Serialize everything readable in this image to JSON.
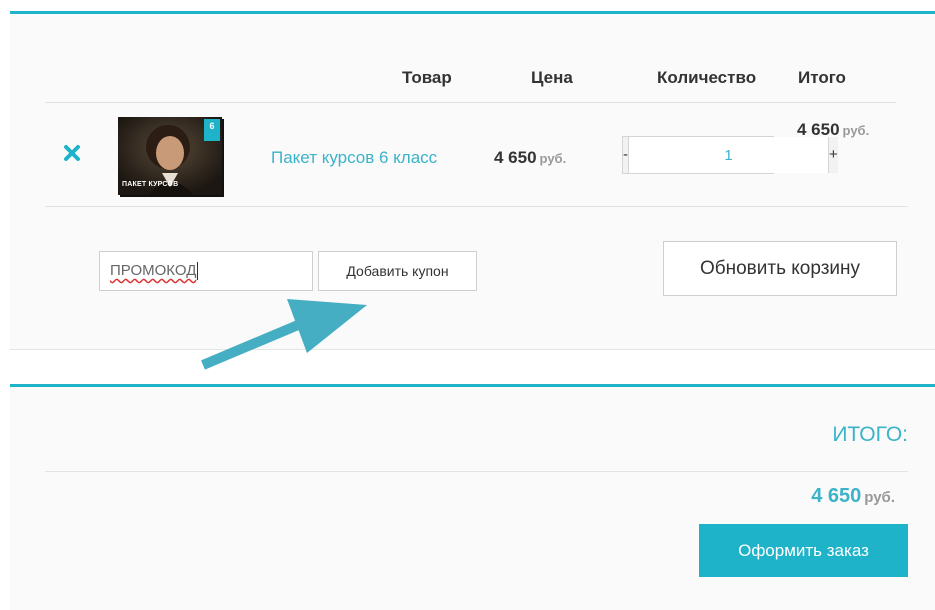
{
  "colors": {
    "accent": "#1fb3c9",
    "link": "#3bb3c9",
    "muted": "#999999"
  },
  "cart": {
    "headers": {
      "product": "Товар",
      "price": "Цена",
      "quantity": "Количество",
      "total": "Итого"
    },
    "items": [
      {
        "remove_icon": "close-icon",
        "thumbnail": {
          "caption": "ПАКЕТ КУРСОВ",
          "badge": "6"
        },
        "name": "Пакет курсов 6 класс",
        "price": "4 650",
        "currency": "руб.",
        "quantity": "1",
        "qty_minus": "-",
        "qty_plus": "+",
        "subtotal": "4 650",
        "subtotal_currency": "руб."
      }
    ],
    "coupon": {
      "value": "ПРОМОКОД",
      "button": "Добавить купон"
    },
    "update_button": "Обновить корзину"
  },
  "totals": {
    "heading": "ИТОГО:",
    "amount": "4 650",
    "currency": "руб.",
    "checkout_button": "Оформить заказ"
  }
}
